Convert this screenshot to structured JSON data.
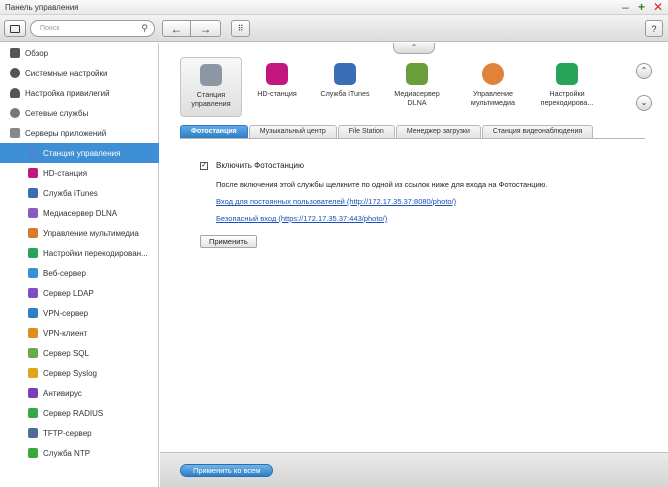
{
  "window": {
    "title": "Панель управления"
  },
  "toolbar": {
    "search_placeholder": "Поиск",
    "back": "←",
    "forward": "→",
    "grid": "⠿",
    "help": "?"
  },
  "sidebar": {
    "top_items": [
      {
        "label": "Обзор"
      },
      {
        "label": "Системные настройки"
      },
      {
        "label": "Настройка привилегий"
      },
      {
        "label": "Сетевые службы"
      },
      {
        "label": "Серверы приложений"
      }
    ],
    "sub_items": [
      {
        "label": "Станция управления",
        "color": "#4a86d6"
      },
      {
        "label": "HD-станция",
        "color": "#c2187e"
      },
      {
        "label": "Служба iTunes",
        "color": "#3a6db5"
      },
      {
        "label": "Медиасервер DLNA",
        "color": "#8a5cc2"
      },
      {
        "label": "Управление мультимедиа",
        "color": "#d97b2a"
      },
      {
        "label": "Настройки перекодирован...",
        "color": "#27a35a"
      },
      {
        "label": "Веб-сервер",
        "color": "#3a8fd6"
      },
      {
        "label": "Сервер LDAP",
        "color": "#7d4fc2"
      },
      {
        "label": "VPN-сервер",
        "color": "#2f7fc5"
      },
      {
        "label": "VPN-клиент",
        "color": "#e38b1c"
      },
      {
        "label": "Сервер SQL",
        "color": "#6aa84f"
      },
      {
        "label": "Сервер Syslog",
        "color": "#e0a419"
      },
      {
        "label": "Антивирус",
        "color": "#7b3fb8"
      },
      {
        "label": "Сервер RADIUS",
        "color": "#35a84a"
      },
      {
        "label": "TFTP-сервер",
        "color": "#4f6d96"
      },
      {
        "label": "Служба NTP",
        "color": "#3aa83a"
      }
    ]
  },
  "apps": [
    {
      "label": "Станция управления",
      "color": "#8d97a3"
    },
    {
      "label": "HD-станция",
      "color": "#c2187e"
    },
    {
      "label": "Служба iTunes",
      "color": "#3a6db5"
    },
    {
      "label": "Медиасервер DLNA",
      "color": "#6a9e3a"
    },
    {
      "label": "Управление мультимедиа",
      "color": "#e0823a"
    },
    {
      "label": "Настройки перекодирова...",
      "color": "#27a35a"
    }
  ],
  "tabs": [
    {
      "label": "Фотостанция"
    },
    {
      "label": "Музыкальный центр"
    },
    {
      "label": "File Station"
    },
    {
      "label": "Менеджер загрузки"
    },
    {
      "label": "Станция видеонаблюдения"
    }
  ],
  "content": {
    "enable_label": "Включить Фотостанцию",
    "checkmark": "✓",
    "description": "После включения этой службы щелкните по одной из ссылок ниже для входа на Фотостанцию.",
    "link_regular": "Вход для постоянных пользователей (http://172.17.35.37:8080/photo/)",
    "link_secure": "Безопасный вход (https://172.17.35.37:443/photo/)",
    "apply": "Применить"
  },
  "footer": {
    "apply_all": "Применить ко всем"
  }
}
